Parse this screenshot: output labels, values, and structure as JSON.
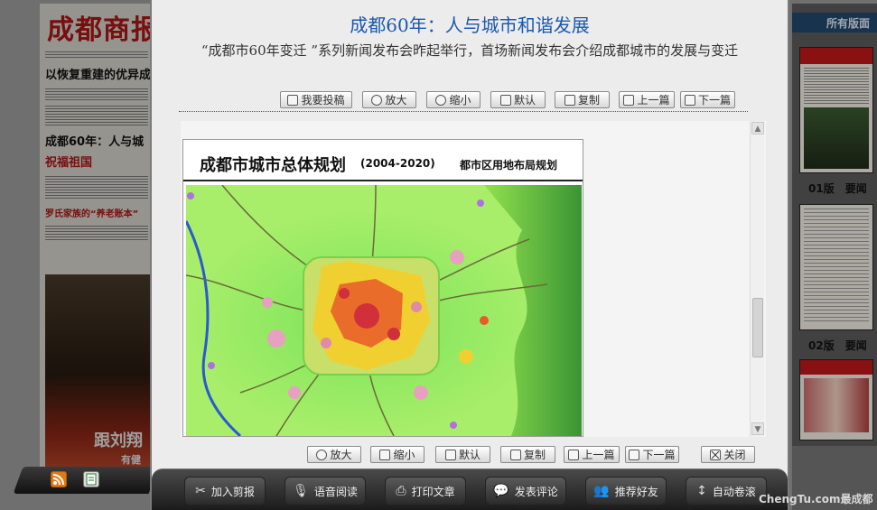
{
  "newspaper": {
    "masthead": "成都商报",
    "headline_1": "以恢复重建的优异成",
    "headline_2": "成都60年：人与城",
    "headline_3": "祝福祖国",
    "feature": "罗氏家族的“养老账本”",
    "photo_caption": "跟刘翔",
    "photo_sub": "有健"
  },
  "sidebar": {
    "title": "所有版面",
    "pages": [
      {
        "label": "01版　要闻"
      },
      {
        "label": "02版　要闻"
      }
    ]
  },
  "article": {
    "title": "成都60年：人与城市和谐发展",
    "subtitle": "“成都市60年变迁 ”系列新闻发布会昨起举行，首场新闻发布会介绍成都城市的发展与变迁"
  },
  "top_toolbar": {
    "submit": "我要投稿",
    "zoom_in": "放大",
    "zoom_out": "缩小",
    "default": "默认",
    "copy": "复制",
    "prev": "上一篇",
    "next": "下一篇"
  },
  "bottom_toolbar": {
    "zoom_in": "放大",
    "zoom_out": "缩小",
    "default": "默认",
    "copy": "复制",
    "prev": "上一篇",
    "next": "下一篇",
    "close": "关闭"
  },
  "map": {
    "title": "成都市城市总体规划",
    "years": "(2004-2020)",
    "subtitle": "都市区用地布局规划"
  },
  "main_toolbar": {
    "clip": "加入剪报",
    "voice": "语音阅读",
    "print": "打印文章",
    "comment": "发表评论",
    "recommend": "推荐好友",
    "autoscroll": "自动卷滚"
  },
  "watermark": "ChengTu.com最成都",
  "colors": {
    "title_blue": "#1b58b0",
    "map_green": "#8ee04a",
    "urban_red": "#e0303a",
    "toolbar_dark": "#2a2a2a"
  }
}
